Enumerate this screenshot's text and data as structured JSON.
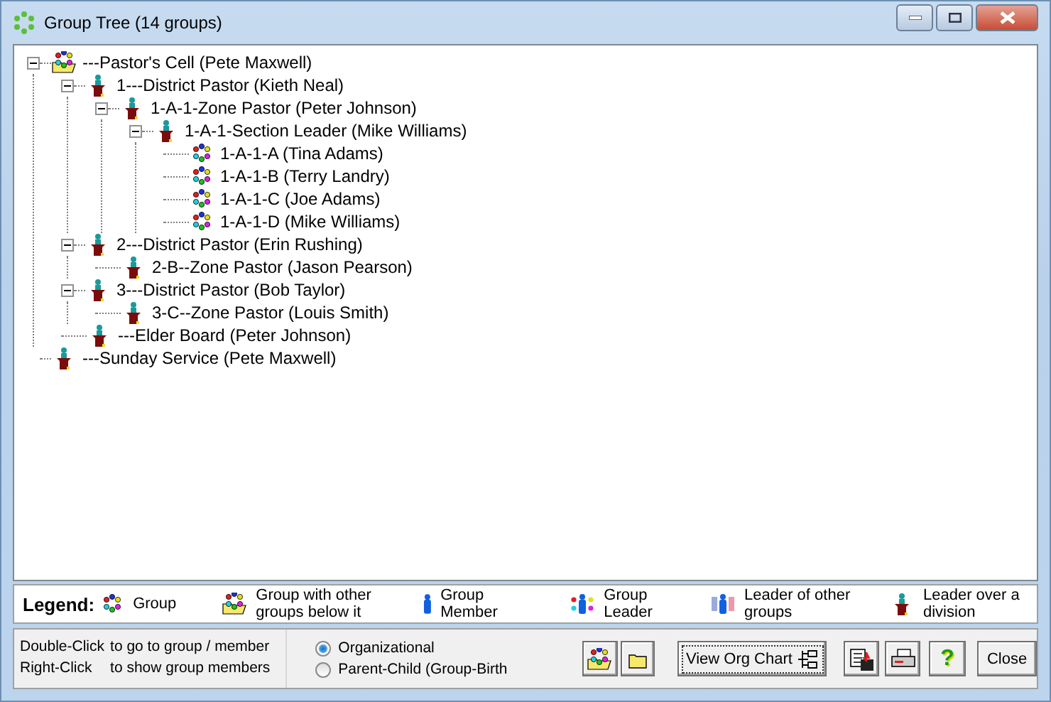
{
  "window": {
    "title": "Group Tree (14 groups)"
  },
  "tree": [
    {
      "label": "---Pastor's Cell (Pete Maxwell)",
      "kind": "parent-group",
      "expanded": true,
      "children": [
        {
          "label": "1---District Pastor (Kieth Neal)",
          "kind": "division-leader",
          "expanded": true,
          "children": [
            {
              "label": "1-A-1-Zone Pastor (Peter Johnson)",
              "kind": "division-leader",
              "expanded": true,
              "children": [
                {
                  "label": "1-A-1-Section Leader (Mike Williams)",
                  "kind": "division-leader",
                  "expanded": true,
                  "children": [
                    {
                      "label": "1-A-1-A (Tina Adams)",
                      "kind": "group"
                    },
                    {
                      "label": "1-A-1-B (Terry Landry)",
                      "kind": "group"
                    },
                    {
                      "label": "1-A-1-C (Joe Adams)",
                      "kind": "group"
                    },
                    {
                      "label": "1-A-1-D (Mike Williams)",
                      "kind": "group"
                    }
                  ]
                }
              ]
            }
          ]
        },
        {
          "label": "2---District Pastor (Erin Rushing)",
          "kind": "division-leader",
          "expanded": true,
          "children": [
            {
              "label": "2-B--Zone Pastor (Jason Pearson)",
              "kind": "division-leader"
            }
          ]
        },
        {
          "label": "3---District Pastor (Bob Taylor)",
          "kind": "division-leader",
          "expanded": true,
          "children": [
            {
              "label": "3-C--Zone Pastor (Louis Smith)",
              "kind": "division-leader"
            }
          ]
        },
        {
          "label": "---Elder Board (Peter Johnson)",
          "kind": "division-leader"
        }
      ]
    },
    {
      "label": "---Sunday Service (Pete Maxwell)",
      "kind": "division-leader"
    }
  ],
  "legend": {
    "title": "Legend:",
    "items": [
      {
        "kind": "group",
        "label": "Group"
      },
      {
        "kind": "parent-group",
        "label": "Group with other groups below it"
      },
      {
        "kind": "member",
        "label": "Group Member"
      },
      {
        "kind": "leader",
        "label": "Group Leader"
      },
      {
        "kind": "leader-of-groups",
        "label": "Leader of other groups"
      },
      {
        "kind": "division-leader",
        "label": "Leader over a division"
      }
    ]
  },
  "help": [
    {
      "action": "Double-Click",
      "text": "to go to group / member"
    },
    {
      "action": "Right-Click",
      "text": "to show group members"
    }
  ],
  "view_mode": [
    {
      "label": "Organizational",
      "selected": true
    },
    {
      "label": "Parent-Child (Group-Birth",
      "selected": false
    }
  ],
  "buttons": [
    {
      "kind": "parent-group"
    },
    {
      "kind": "folder"
    },
    {
      "kind": "org-chart",
      "label": "View Org Chart"
    },
    {
      "kind": "export"
    },
    {
      "kind": "print"
    },
    {
      "kind": "help",
      "label": "?"
    },
    {
      "kind": "text",
      "label": "Close"
    }
  ]
}
